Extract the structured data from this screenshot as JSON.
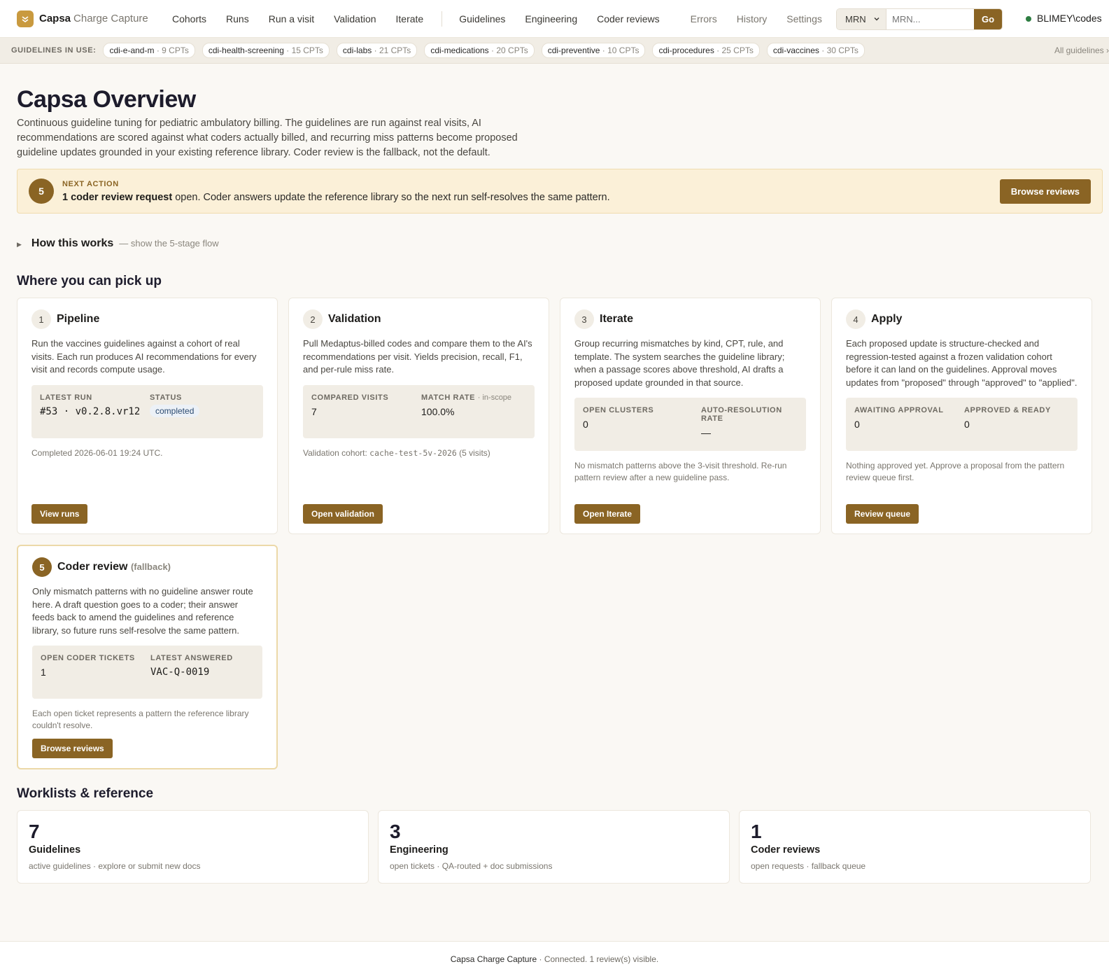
{
  "brand": {
    "name": "Capsa",
    "sub": "Charge Capture"
  },
  "nav": {
    "primary": [
      "Cohorts",
      "Runs",
      "Run a visit",
      "Validation",
      "Iterate"
    ],
    "secondary": [
      "Guidelines",
      "Engineering",
      "Coder reviews"
    ],
    "tertiary": [
      "Errors",
      "History",
      "Settings"
    ]
  },
  "mrn": {
    "select": "MRN",
    "placeholder": "MRN...",
    "go": "Go"
  },
  "user": {
    "name": "BLIMEY\\codes",
    "status_color": "#2e7d42"
  },
  "guidelines_strip": {
    "label": "GUIDELINES IN USE:",
    "chips": [
      {
        "name": "cdi-e-and-m",
        "count": "· 9 CPTs"
      },
      {
        "name": "cdi-health-screening",
        "count": "· 15 CPTs"
      },
      {
        "name": "cdi-labs",
        "count": "· 21 CPTs"
      },
      {
        "name": "cdi-medications",
        "count": "· 20 CPTs"
      },
      {
        "name": "cdi-preventive",
        "count": "· 10 CPTs"
      },
      {
        "name": "cdi-procedures",
        "count": "· 25 CPTs"
      },
      {
        "name": "cdi-vaccines",
        "count": "· 30 CPTs"
      }
    ],
    "all": "All guidelines ›"
  },
  "page": {
    "title": "Capsa Overview",
    "intro": "Continuous guideline tuning for pediatric ambulatory billing. The guidelines are run against real visits, AI recommendations are scored against what coders actually billed, and recurring miss patterns become proposed guideline updates grounded in your existing reference library. Coder review is the fallback, not the default."
  },
  "next_action": {
    "number": "5",
    "label": "NEXT ACTION",
    "bold": "1 coder review request",
    "text": " open. Coder answers update the reference library so the next run self-resolves the same pattern.",
    "button": "Browse reviews"
  },
  "how": {
    "title": "How this works",
    "sub": "— show the 5-stage flow"
  },
  "pickup": {
    "title": "Where you can pick up",
    "cards": [
      {
        "num": "1",
        "title": "Pipeline",
        "desc": "Run the vaccines guidelines against a cohort of real visits. Each run produces AI recommendations for every visit and records compute usage.",
        "s1_label": "LATEST RUN",
        "s1_val": "#53 · v0.2.8.vr12",
        "s2_label": "STATUS",
        "s2_val": "completed",
        "note": "Completed 2026-06-01 19:24 UTC.",
        "button": "View runs"
      },
      {
        "num": "2",
        "title": "Validation",
        "desc": "Pull Medaptus-billed codes and compare them to the AI's recommendations per visit. Yields precision, recall, F1, and per-rule miss rate.",
        "s1_label": "COMPARED VISITS",
        "s1_val": "7",
        "s2_label": "MATCH RATE",
        "s2_label_sm": "· in-scope",
        "s2_val": "100.0%",
        "note_pre": "Validation cohort: ",
        "note_code": "cache-test-5v-2026",
        "note_post": " (5 visits)",
        "button": "Open validation"
      },
      {
        "num": "3",
        "title": "Iterate",
        "desc": "Group recurring mismatches by kind, CPT, rule, and template. The system searches the guideline library; when a passage scores above threshold, AI drafts a proposed update grounded in that source.",
        "s1_label": "OPEN CLUSTERS",
        "s1_val": "0",
        "s2_label": "AUTO-RESOLUTION RATE",
        "s2_val": "—",
        "note": "No mismatch patterns above the 3-visit threshold. Re-run pattern review after a new guideline pass.",
        "button": "Open Iterate"
      },
      {
        "num": "4",
        "title": "Apply",
        "desc": "Each proposed update is structure-checked and regression-tested against a frozen validation cohort before it can land on the guidelines. Approval moves updates from \"proposed\" through \"approved\" to \"applied\".",
        "s1_label": "AWAITING APPROVAL",
        "s1_val": "0",
        "s2_label": "APPROVED & READY",
        "s2_val": "0",
        "note": "Nothing approved yet. Approve a proposal from the pattern review queue first.",
        "button": "Review queue"
      },
      {
        "num": "5",
        "title": "Coder review",
        "title_sm": "(fallback)",
        "desc": "Only mismatch patterns with no guideline answer route here. A draft question goes to a coder; their answer feeds back to amend the guidelines and reference library, so future runs self-resolve the same pattern.",
        "s1_label": "OPEN CODER TICKETS",
        "s1_val": "1",
        "s2_label": "LATEST ANSWERED",
        "s2_val": "VAC-Q-0019",
        "note": "Each open ticket represents a pattern the reference library couldn't resolve.",
        "button": "Browse reviews"
      }
    ]
  },
  "worklists": {
    "title": "Worklists & reference",
    "items": [
      {
        "num": "7",
        "title": "Guidelines",
        "sub": "active guidelines · explore or submit new docs"
      },
      {
        "num": "3",
        "title": "Engineering",
        "sub": "open tickets · QA-routed + doc submissions"
      },
      {
        "num": "1",
        "title": "Coder reviews",
        "sub": "open requests · fallback queue"
      }
    ]
  },
  "footer": {
    "brand": "Capsa Charge Capture",
    "text": " · Connected. 1 review(s) visible."
  },
  "colors": {
    "accent": "#8a6424",
    "banner_bg": "#fbf0d8",
    "page_bg": "#faf8f4"
  }
}
